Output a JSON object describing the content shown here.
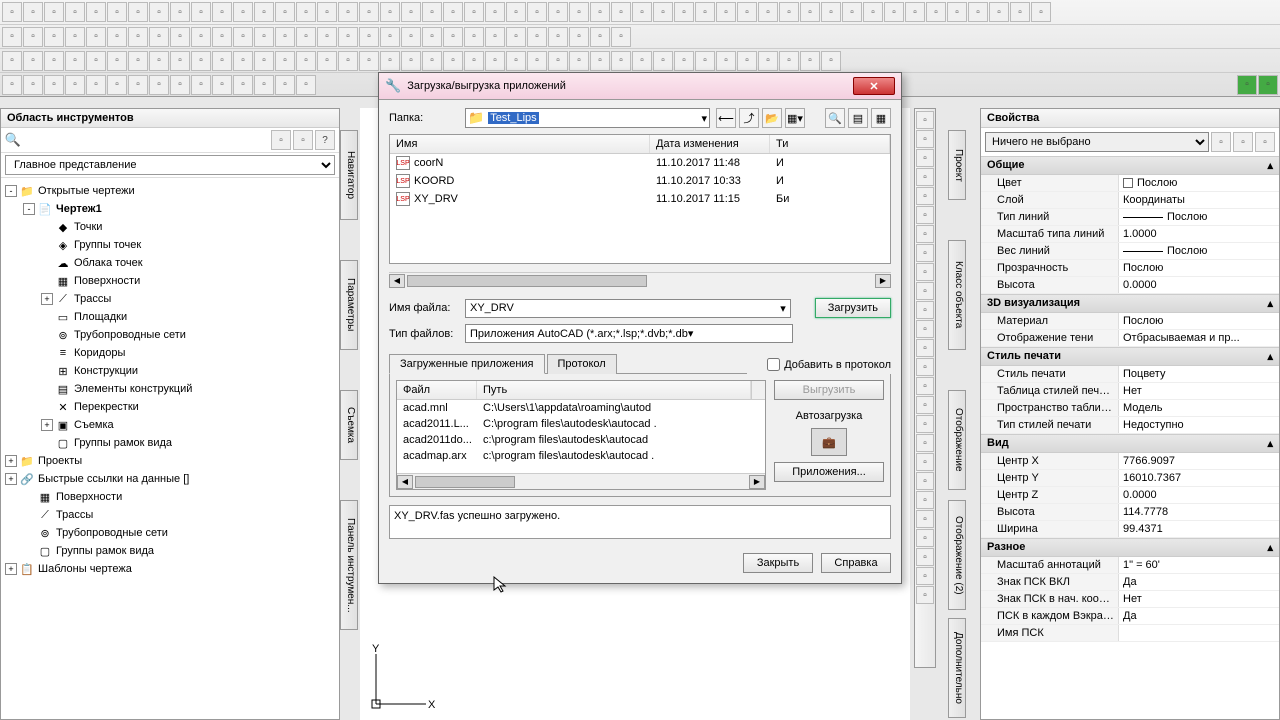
{
  "left_panel": {
    "title": "Область инструментов",
    "dropdown": "Главное представление",
    "tree": [
      {
        "indent": 0,
        "toggle": "-",
        "icon": "📁",
        "label": "Открытые чертежи"
      },
      {
        "indent": 1,
        "toggle": "-",
        "icon": "📄",
        "label": "Чертеж1",
        "bold": true
      },
      {
        "indent": 2,
        "toggle": "",
        "icon": "◆",
        "label": "Точки"
      },
      {
        "indent": 2,
        "toggle": "",
        "icon": "◈",
        "label": "Группы точек"
      },
      {
        "indent": 2,
        "toggle": "",
        "icon": "☁",
        "label": "Облака точек"
      },
      {
        "indent": 2,
        "toggle": "",
        "icon": "▦",
        "label": "Поверхности"
      },
      {
        "indent": 2,
        "toggle": "+",
        "icon": "⟋",
        "label": "Трассы"
      },
      {
        "indent": 2,
        "toggle": "",
        "icon": "▭",
        "label": "Площадки"
      },
      {
        "indent": 2,
        "toggle": "",
        "icon": "⊚",
        "label": "Трубопроводные сети"
      },
      {
        "indent": 2,
        "toggle": "",
        "icon": "≡",
        "label": "Коридоры"
      },
      {
        "indent": 2,
        "toggle": "",
        "icon": "⊞",
        "label": "Конструкции"
      },
      {
        "indent": 2,
        "toggle": "",
        "icon": "▤",
        "label": "Элементы конструкций"
      },
      {
        "indent": 2,
        "toggle": "",
        "icon": "✕",
        "label": "Перекрестки"
      },
      {
        "indent": 2,
        "toggle": "+",
        "icon": "▣",
        "label": "Съемка"
      },
      {
        "indent": 2,
        "toggle": "",
        "icon": "▢",
        "label": "Группы рамок вида"
      },
      {
        "indent": 0,
        "toggle": "+",
        "icon": "📁",
        "label": "Проекты"
      },
      {
        "indent": 0,
        "toggle": "+",
        "icon": "🔗",
        "label": "Быстрые ссылки на данные []"
      },
      {
        "indent": 1,
        "toggle": "",
        "icon": "▦",
        "label": "Поверхности"
      },
      {
        "indent": 1,
        "toggle": "",
        "icon": "⟋",
        "label": "Трассы"
      },
      {
        "indent": 1,
        "toggle": "",
        "icon": "⊚",
        "label": "Трубопроводные сети"
      },
      {
        "indent": 1,
        "toggle": "",
        "icon": "▢",
        "label": "Группы рамок вида"
      },
      {
        "indent": 0,
        "toggle": "+",
        "icon": "📋",
        "label": "Шаблоны чертежа"
      }
    ]
  },
  "vtabs": {
    "navigator": "Навигатор",
    "params": "Параметры",
    "survey": "Съемка",
    "toolpanel": "Панель инструмен...",
    "project": "Проект",
    "objclass": "Класс объекта",
    "display": "Отображение",
    "display2": "Отображение (2)",
    "additional": "Дополнительно"
  },
  "dialog": {
    "title": "Загрузка/выгрузка приложений",
    "folder_label": "Папка:",
    "folder_value": "Test_Lips",
    "columns": {
      "name": "Имя",
      "date": "Дата изменения",
      "type": "Ти"
    },
    "files": [
      {
        "name": "coorN",
        "date": "11.10.2017 11:48",
        "type": "И"
      },
      {
        "name": "KOORD",
        "date": "11.10.2017 10:33",
        "type": "И"
      },
      {
        "name": "XY_DRV",
        "date": "11.10.2017 11:15",
        "type": "Би"
      }
    ],
    "filename_label": "Имя файла:",
    "filename_value": "XY_DRV",
    "filetype_label": "Тип файлов:",
    "filetype_value": "Приложения AutoCAD (*.arx;*.lsp;*.dvb;*.db",
    "load_btn": "Загрузить",
    "tab_loaded": "Загруженные приложения",
    "tab_log": "Протокол",
    "add_to_log": "Добавить в протокол",
    "unload_btn": "Выгрузить",
    "autoload_label": "Автозагрузка",
    "apps_btn": "Приложения...",
    "loaded_cols": {
      "file": "Файл",
      "path": "Путь"
    },
    "loaded": [
      {
        "file": "acad.mnl",
        "path": "C:\\Users\\1\\appdata\\roaming\\autod"
      },
      {
        "file": "acad2011.L...",
        "path": "C:\\program files\\autodesk\\autocad ."
      },
      {
        "file": "acad2011do...",
        "path": "c:\\program files\\autodesk\\autocad"
      },
      {
        "file": "acadmap.arx",
        "path": "c:\\program files\\autodesk\\autocad ."
      }
    ],
    "status": "XY_DRV.fas успешно загружено.",
    "close_btn": "Закрыть",
    "help_btn": "Справка"
  },
  "props": {
    "title": "Свойства",
    "selector": "Ничего не выбрано",
    "sections": [
      {
        "name": "Общие",
        "rows": [
          {
            "k": "Цвет",
            "v": "Послою",
            "swatch": true
          },
          {
            "k": "Слой",
            "v": "Координаты"
          },
          {
            "k": "Тип линий",
            "v": "Послою",
            "line": true
          },
          {
            "k": "Масштаб типа линий",
            "v": "1.0000"
          },
          {
            "k": "Вес линий",
            "v": "Послою",
            "line": true
          },
          {
            "k": "Прозрачность",
            "v": "Послою"
          },
          {
            "k": "Высота",
            "v": "0.0000"
          }
        ]
      },
      {
        "name": "3D визуализация",
        "rows": [
          {
            "k": "Материал",
            "v": "Послою"
          },
          {
            "k": "Отображение тени",
            "v": "Отбрасываемая и пр..."
          }
        ]
      },
      {
        "name": "Стиль печати",
        "rows": [
          {
            "k": "Стиль печати",
            "v": "Поцвету"
          },
          {
            "k": "Таблица стилей печати",
            "v": "Нет"
          },
          {
            "k": "Пространство таблиц...",
            "v": "Модель"
          },
          {
            "k": "Тип стилей печати",
            "v": "Недоступно"
          }
        ]
      },
      {
        "name": "Вид",
        "rows": [
          {
            "k": "Центр X",
            "v": "7766.9097"
          },
          {
            "k": "Центр Y",
            "v": "16010.7367"
          },
          {
            "k": "Центр Z",
            "v": "0.0000"
          },
          {
            "k": "Высота",
            "v": "114.7778"
          },
          {
            "k": "Ширина",
            "v": "99.4371"
          }
        ]
      },
      {
        "name": "Разное",
        "rows": [
          {
            "k": "Масштаб аннотаций",
            "v": "1\" = 60'"
          },
          {
            "k": "Знак ПСК ВКЛ",
            "v": "Да"
          },
          {
            "k": "Знак ПСК в нач. коорд.",
            "v": "Нет"
          },
          {
            "k": "ПСК в каждом Вэкране",
            "v": "Да"
          },
          {
            "k": "Имя ПСК",
            "v": ""
          }
        ]
      }
    ]
  }
}
